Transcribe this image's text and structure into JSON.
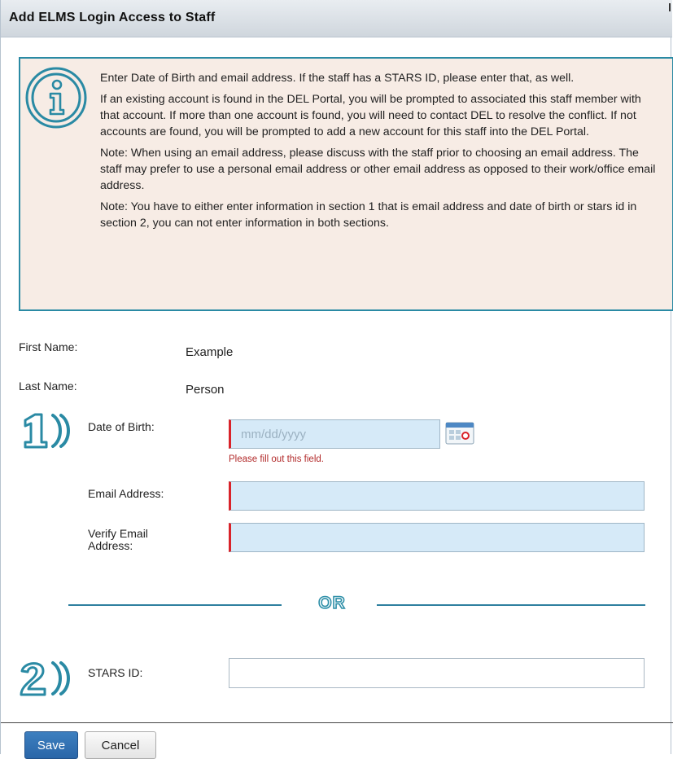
{
  "dialog": {
    "title": "Add ELMS Login Access to Staff"
  },
  "info": {
    "paragraphs": [
      "Enter Date of Birth and email address. If the staff has a STARS ID, please enter that, as well.",
      "If an existing account is found in the DEL Portal, you will be prompted to associated this staff member with that account. If more than one account is found, you will need to contact DEL to resolve the conflict. If not accounts are found, you will be prompted to add a new account for this staff into the DEL Portal.",
      "Note: When using an email address, please discuss with the staff prior to choosing an email address. The staff may prefer to use a personal email address or other email address as opposed to their work/office email address.",
      "Note: You have to either enter information in section 1 that is email address and date of birth or stars id in section 2, you can not enter information in both sections."
    ],
    "icon": "info-icon"
  },
  "person": {
    "first_name_label": "First Name:",
    "first_name_value": "Example",
    "last_name_label": "Last Name:",
    "last_name_value": "Person"
  },
  "section1": {
    "number_icon": "number-1-icon",
    "dob_label": "Date of Birth:",
    "dob_value": "",
    "dob_placeholder": "mm/dd/yyyy",
    "dob_error": "Please fill out this field.",
    "calendar_icon": "calendar-icon",
    "email_label": "Email Address:",
    "email_value": "",
    "verify_email_label_line1": "Verify Email",
    "verify_email_label_line2": "Address:",
    "verify_email_value": ""
  },
  "divider": {
    "or_text": "OR"
  },
  "section2": {
    "number_icon": "number-2-icon",
    "stars_label": "STARS ID:",
    "stars_value": ""
  },
  "footer": {
    "save_label": "Save",
    "cancel_label": "Cancel"
  },
  "colors": {
    "accent": "#2a8aa4",
    "info_background": "#f7ece5",
    "required_marker": "#d9232a",
    "field_background": "#d6eaf8",
    "error_text": "#b22a2a",
    "save_button": "#2a66a8"
  }
}
